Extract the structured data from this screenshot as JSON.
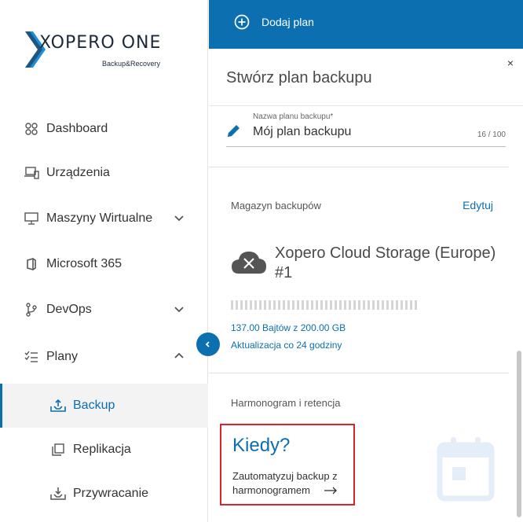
{
  "brand": {
    "name": "XOPERO ONE",
    "tagline": "Backup&Recovery"
  },
  "sidebar": {
    "items": [
      {
        "label": "Dashboard",
        "icon": "dashboard-icon"
      },
      {
        "label": "Urządzenia",
        "icon": "devices-icon"
      },
      {
        "label": "Maszyny Wirtualne",
        "icon": "monitor-icon",
        "expanded": false
      },
      {
        "label": "Microsoft 365",
        "icon": "office-icon"
      },
      {
        "label": "DevOps",
        "icon": "branch-icon",
        "expanded": false
      },
      {
        "label": "Plany",
        "icon": "checklist-icon",
        "expanded": true
      }
    ],
    "subitems": [
      {
        "label": "Backup",
        "icon": "backup-icon",
        "active": true
      },
      {
        "label": "Replikacja",
        "icon": "copy-icon"
      },
      {
        "label": "Przywracanie",
        "icon": "restore-icon"
      }
    ]
  },
  "topbar": {
    "add_plan_label": "Dodaj plan"
  },
  "panel": {
    "close_label": "×",
    "title": "Stwórz plan backupu",
    "name_field": {
      "label": "Nazwa planu backupu*",
      "value": "Mój plan backupu",
      "counter": "16 / 100"
    },
    "storage": {
      "section_title": "Magazyn backupów",
      "edit_label": "Edytuj",
      "name": "Xopero Cloud Storage (Europe) #1",
      "usage": "137.00 Bajtów z 200.00 GB",
      "update": "Aktualizacja co 24 godziny"
    },
    "schedule": {
      "section_title": "Harmonogram i retencja",
      "when_title": "Kiedy?",
      "when_desc": "Zautomatyzuj backup z harmonogramem"
    }
  },
  "colors": {
    "accent": "#0b6fb0",
    "highlight": "#d9232f"
  }
}
